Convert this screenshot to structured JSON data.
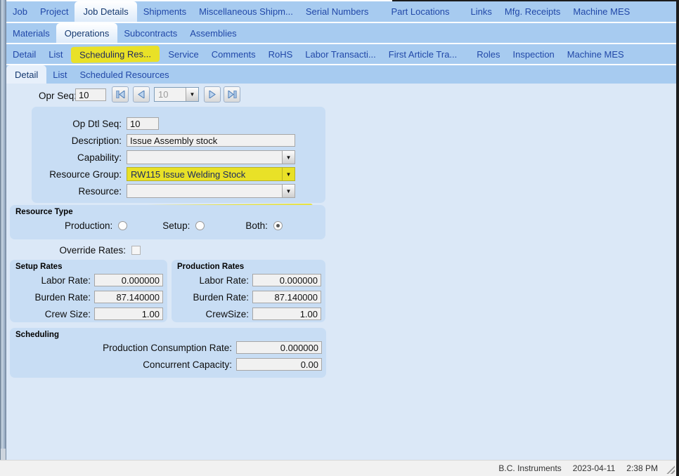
{
  "colors": {
    "highlight_marker": "#e9e127",
    "tab_text": "#2148a8",
    "tab_bar": "#a7cbf0"
  },
  "icons": {
    "dropdown": "▼",
    "nav_first": "skip-to-first",
    "nav_prev": "previous",
    "nav_next": "next",
    "nav_last": "skip-to-last"
  },
  "tabs": {
    "level1": {
      "items": [
        "Job",
        "Project",
        "Job Details",
        "Shipments",
        "Miscellaneous Shipm...",
        "Serial Numbers",
        "Part Locations",
        "Links",
        "Mfg. Receipts",
        "Machine MES"
      ],
      "active": "Job Details"
    },
    "level2": {
      "items": [
        "Materials",
        "Operations",
        "Subcontracts",
        "Assemblies"
      ],
      "active": "Operations"
    },
    "level3": {
      "items": [
        "Detail",
        "List",
        "Scheduling Res...",
        "Service",
        "Comments",
        "RoHS",
        "Labor Transacti...",
        "First Article Tra...",
        "Roles",
        "Inspection",
        "Machine MES"
      ],
      "active": "Scheduling Res...",
      "highlighted": "Scheduling Res..."
    },
    "level4": {
      "items": [
        "Detail",
        "List",
        "Scheduled Resources"
      ],
      "active": "Detail"
    }
  },
  "toolbar": {
    "opr_seq_label": "Opr Seq:",
    "opr_seq_value": "10",
    "nav_combo_value": "10"
  },
  "detail_form": {
    "op_dtl_seq": {
      "label": "Op Dtl Seq:",
      "value": "10"
    },
    "description": {
      "label": "Description:",
      "value": "Issue Assembly stock"
    },
    "capability": {
      "label": "Capability:",
      "value": ""
    },
    "resource_group": {
      "label": "Resource Group:",
      "value": "RW115 Issue Welding Stock",
      "highlighted": true
    },
    "resource": {
      "label": "Resource:",
      "value": ""
    }
  },
  "resource_type": {
    "title": "Resource Type",
    "options": [
      {
        "label": "Production:",
        "selected": false
      },
      {
        "label": "Setup:",
        "selected": false
      },
      {
        "label": "Both:",
        "selected": true
      }
    ]
  },
  "override_rates": {
    "label": "Override Rates:",
    "checked": false
  },
  "setup_rates": {
    "title": "Setup Rates",
    "rows": [
      {
        "label": "Labor Rate:",
        "value": "0.000000"
      },
      {
        "label": "Burden Rate:",
        "value": "87.140000"
      },
      {
        "label": "Crew Size:",
        "value": "1.00"
      }
    ]
  },
  "production_rates": {
    "title": "Production Rates",
    "rows": [
      {
        "label": "Labor Rate:",
        "value": "0.000000"
      },
      {
        "label": "Burden Rate:",
        "value": "87.140000"
      },
      {
        "label": "CrewSize:",
        "value": "1.00"
      }
    ]
  },
  "scheduling": {
    "title": "Scheduling",
    "rows": [
      {
        "label": "Production Consumption Rate:",
        "value": "0.000000"
      },
      {
        "label": "Concurrent Capacity:",
        "value": "0.00"
      }
    ]
  },
  "statusbar": {
    "company": "B.C. Instruments",
    "date": "2023-04-11",
    "time": "2:38 PM"
  }
}
